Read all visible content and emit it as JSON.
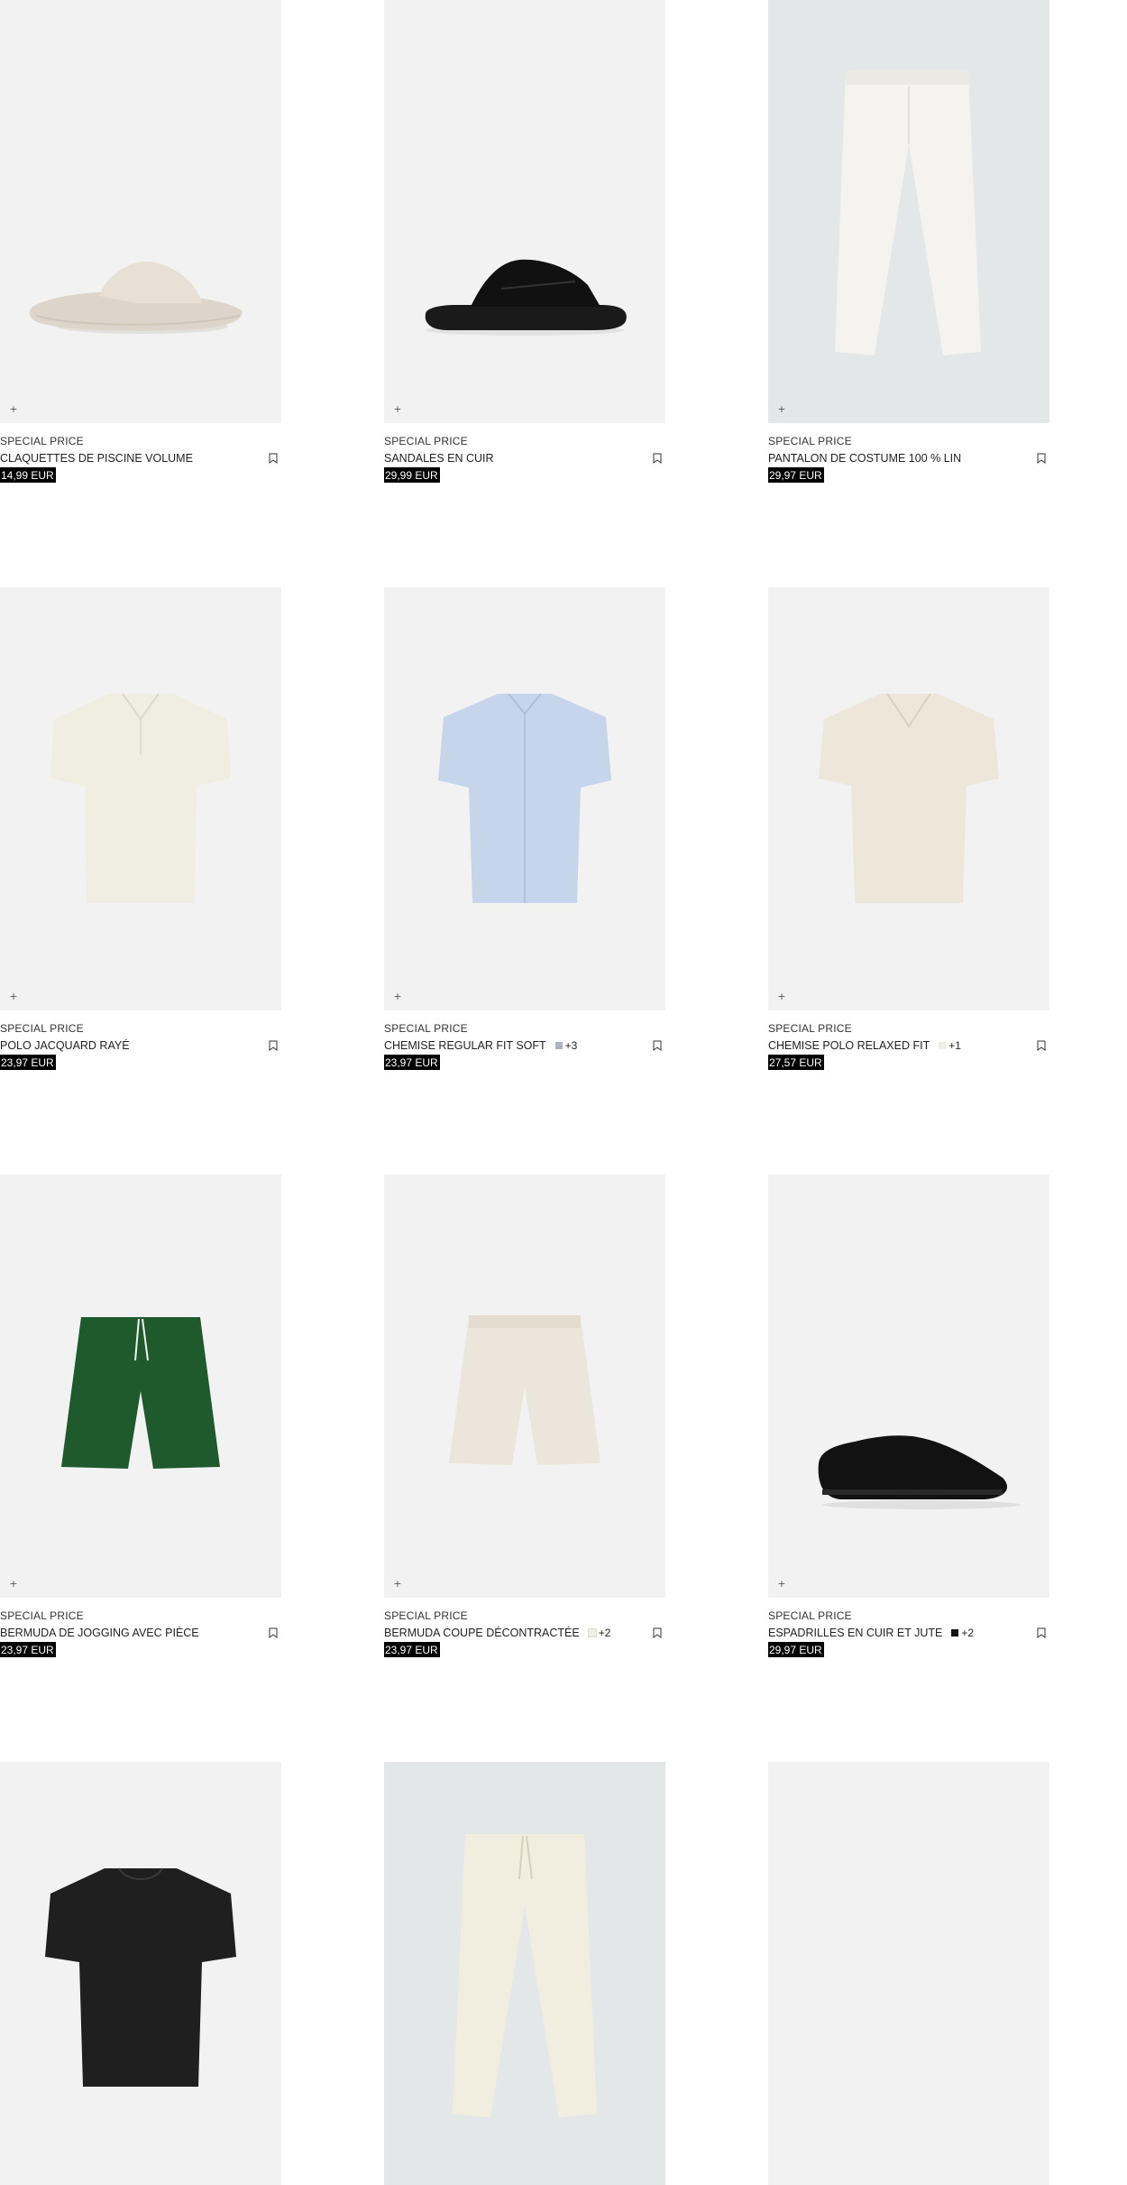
{
  "products": [
    {
      "label": "SPECIAL PRICE",
      "name": "CLAQUETTES DE PISCINE VOLUME",
      "price": "14,99 EUR",
      "swatch_color": null,
      "more_colors": null,
      "image_icon": "slide-sandal-beige"
    },
    {
      "label": "SPECIAL PRICE",
      "name": "SANDALES EN CUIR",
      "price": "29,99 EUR",
      "swatch_color": null,
      "more_colors": null,
      "image_icon": "strap-sandal-black"
    },
    {
      "label": "SPECIAL PRICE",
      "name": "PANTALON DE COSTUME 100 % LIN",
      "price": "29,97 EUR",
      "swatch_color": null,
      "more_colors": null,
      "image_icon": "linen-trousers-white"
    },
    {
      "label": "SPECIAL PRICE",
      "name": "POLO JACQUARD RAYÉ",
      "price": "23,97 EUR",
      "swatch_color": null,
      "more_colors": null,
      "image_icon": "polo-cream"
    },
    {
      "label": "SPECIAL PRICE",
      "name": "CHEMISE REGULAR FIT SOFT",
      "price": "23,97 EUR",
      "swatch_color": "#a9b3bd",
      "more_colors": "+3",
      "image_icon": "shirt-light-blue"
    },
    {
      "label": "SPECIAL PRICE",
      "name": "CHEMISE POLO RELAXED FIT",
      "price": "27,57 EUR",
      "swatch_color": "#efede6",
      "more_colors": "+1",
      "image_icon": "polo-shirt-beige"
    },
    {
      "label": "SPECIAL PRICE",
      "name": "BERMUDA DE JOGGING AVEC PIÈCE",
      "price": "23,97 EUR",
      "swatch_color": null,
      "more_colors": null,
      "image_icon": "shorts-green"
    },
    {
      "label": "SPECIAL PRICE",
      "name": "BERMUDA COUPE DÉCONTRACTÉE",
      "price": "23,97 EUR",
      "swatch_color": "#efede6",
      "more_colors": "+2",
      "image_icon": "shorts-beige"
    },
    {
      "label": "SPECIAL PRICE",
      "name": "ESPADRILLES EN CUIR ET JUTE",
      "price": "29,97 EUR",
      "swatch_color": "#111111",
      "more_colors": "+2",
      "image_icon": "sneaker-black"
    },
    {
      "label": "",
      "name": "",
      "price": "",
      "swatch_color": null,
      "more_colors": null,
      "image_icon": "tshirt-black"
    },
    {
      "label": "",
      "name": "",
      "price": "",
      "swatch_color": null,
      "more_colors": null,
      "image_icon": "trousers-cream"
    },
    {
      "label": "",
      "name": "",
      "price": "",
      "swatch_color": null,
      "more_colors": null,
      "image_icon": "product-image"
    }
  ],
  "ui": {
    "plus_icon": "+",
    "bookmark_icon": "bookmark-icon"
  }
}
